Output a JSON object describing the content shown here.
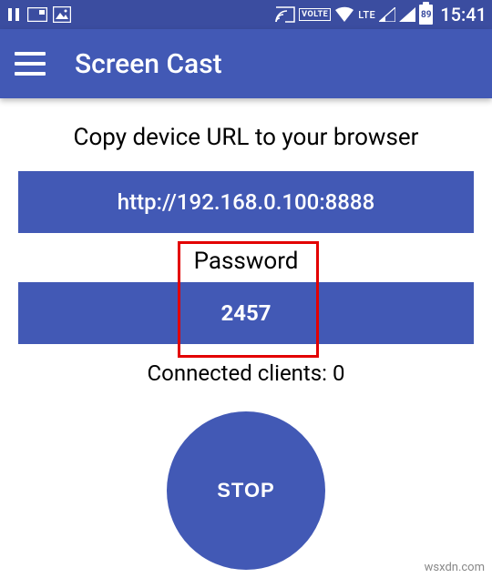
{
  "status": {
    "volte": "VOLTE",
    "lte": "LTE",
    "battery": "89",
    "time": "15:41"
  },
  "appbar": {
    "title": "Screen Cast"
  },
  "main": {
    "instruction": "Copy device URL to your browser",
    "url": "http://192.168.0.100:8888",
    "password_label": "Password",
    "password": "2457",
    "clients_label": "Connected clients: 0",
    "stop_label": "STOP"
  },
  "watermark": "wsxdn.com"
}
